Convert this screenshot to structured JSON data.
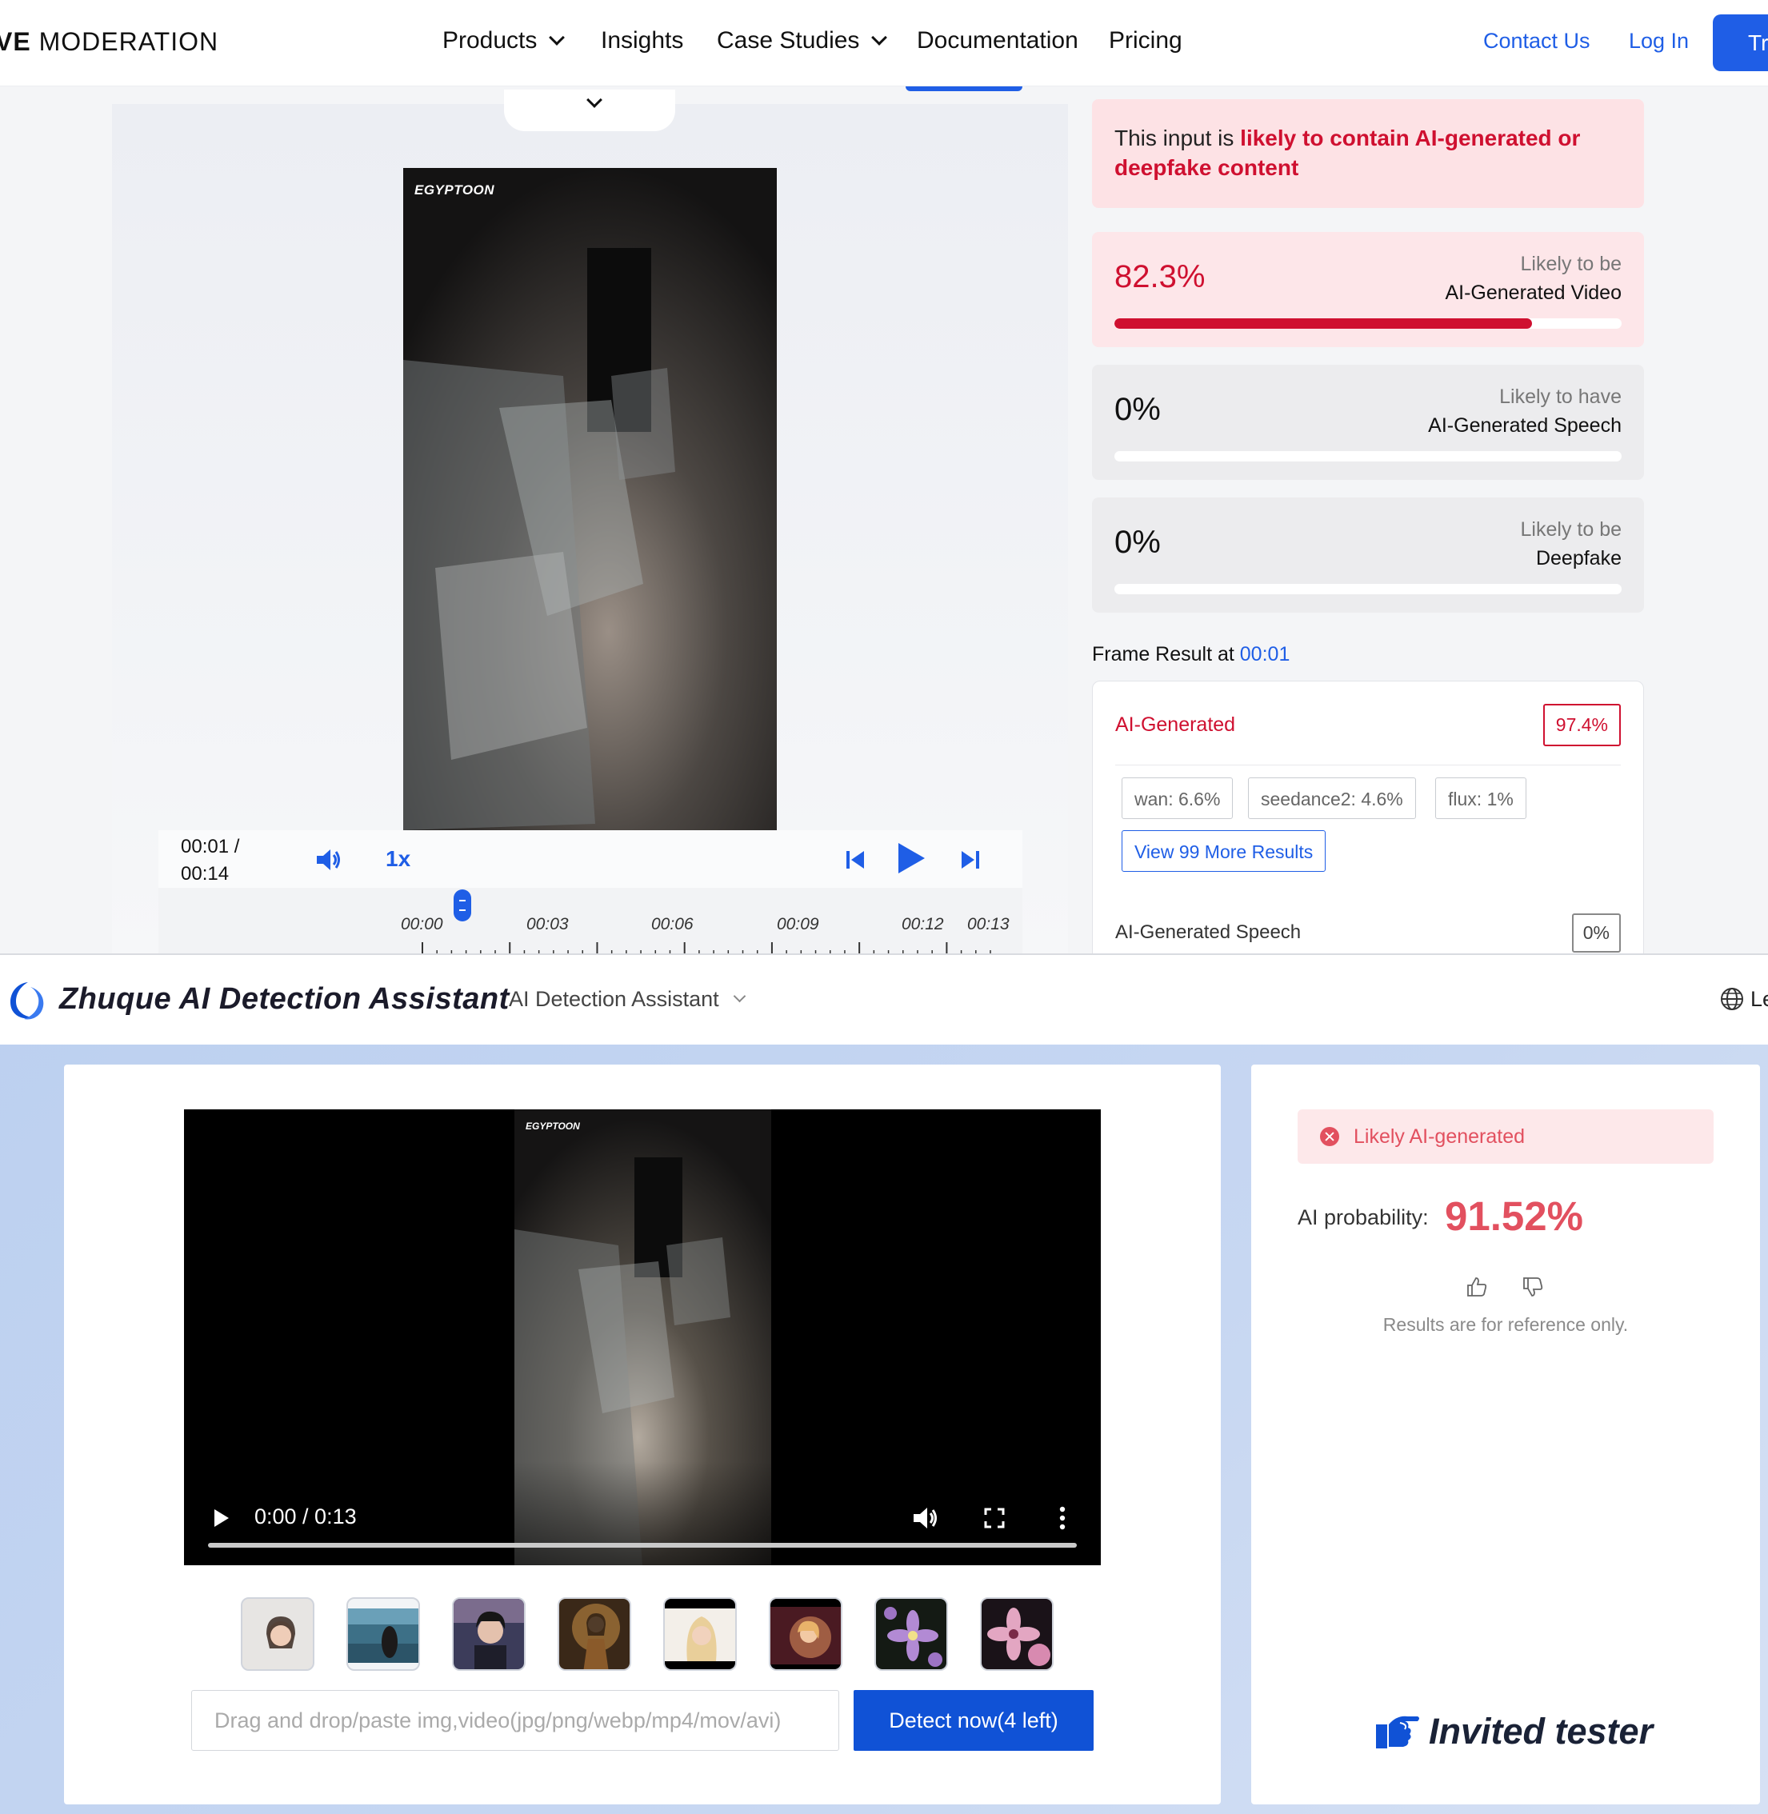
{
  "hive": {
    "brand_bold": "VE",
    "brand_rest": "MODERATION",
    "nav": {
      "products": "Products",
      "insights": "Insights",
      "case_studies": "Case Studies",
      "documentation": "Documentation",
      "pricing": "Pricing",
      "contact": "Contact Us",
      "login": "Log In",
      "try": "Tr"
    },
    "player": {
      "time_current": "00:01 /",
      "time_total": "00:14",
      "speed": "1x",
      "watermark": "EGYPTOON",
      "ticks": [
        "00:00",
        "00:03",
        "00:06",
        "00:09",
        "00:12",
        "00:13"
      ],
      "position_fraction": 0.07
    },
    "alert": {
      "prefix": "This input is ",
      "highlight": "likely to contain AI-generated or deepfake content"
    },
    "scores": [
      {
        "value": "82.3%",
        "percent": 82.3,
        "label_top": "Likely to be",
        "label_bottom": "AI-Generated Video"
      },
      {
        "value": "0%",
        "percent": 0,
        "label_top": "Likely to have",
        "label_bottom": "AI-Generated Speech"
      },
      {
        "value": "0%",
        "percent": 0,
        "label_top": "Likely to be",
        "label_bottom": "Deepfake"
      }
    ],
    "frame": {
      "title_prefix": "Frame Result at ",
      "title_time": "00:01",
      "ai_generated_label": "AI-Generated",
      "ai_generated_pct": "97.4%",
      "chips": [
        "wan: 6.6%",
        "seedance2: 4.6%",
        "flux: 1%"
      ],
      "more_button": "View 99 More Results",
      "speech_label": "AI-Generated Speech",
      "speech_pct": "0%"
    }
  },
  "zhuque": {
    "brand": "Zhuque AI Detection Assistant",
    "menu": "AI Detection Assistant",
    "lang": "Le",
    "video": {
      "watermark": "EGYPTOON",
      "time": "0:00 / 0:13"
    },
    "upload_placeholder": "Drag and drop/paste img,video(jpg/png/webp/mp4/mov/avi)",
    "detect_button": "Detect now(4 left)",
    "result": {
      "status": "Likely AI-generated",
      "prob_label": "AI probability:",
      "prob_value": "91.52%",
      "note": "Results are for reference only.",
      "badge": "Invited tester"
    },
    "colors": {
      "accent_blue": "#1052d6",
      "danger": "#e2505f"
    }
  }
}
